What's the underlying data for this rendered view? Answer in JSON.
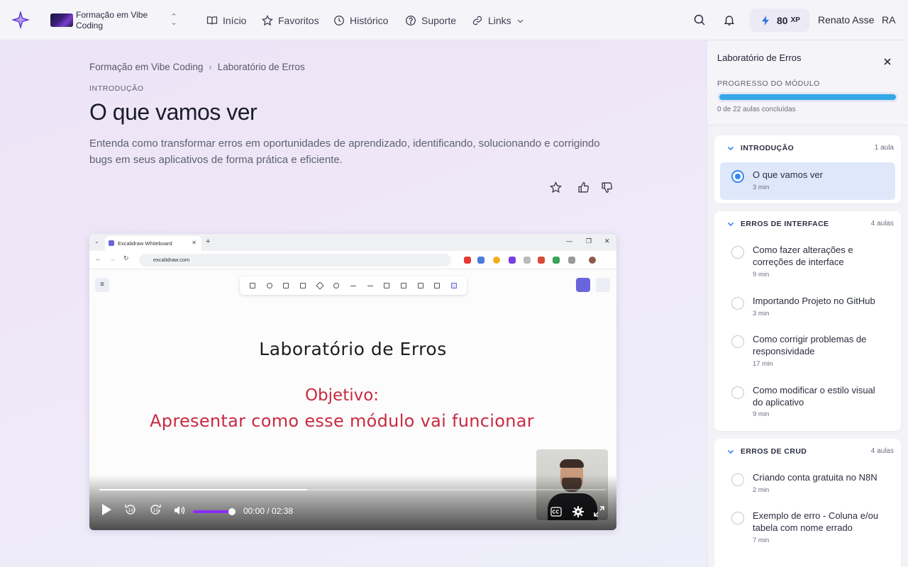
{
  "topbar": {
    "course_name": "Formação em Vibe Coding",
    "nav": [
      {
        "label": "Início",
        "icon": "book-icon"
      },
      {
        "label": "Favoritos",
        "icon": "star-icon"
      },
      {
        "label": "Histórico",
        "icon": "clock-icon"
      },
      {
        "label": "Suporte",
        "icon": "help-circle-icon"
      },
      {
        "label": "Links",
        "icon": "link-icon"
      }
    ],
    "xp_value": "80",
    "xp_unit": "XP",
    "username": "Renato Asse",
    "initials": "RA",
    "accent": "#8b2cf5"
  },
  "main": {
    "breadcrumb": [
      "Formação em Vibe Coding",
      "Laboratório de Erros"
    ],
    "section_label": "INTRODUÇÃO",
    "title": "O que vamos ver",
    "description": "Entenda como transformar erros em oportunidades de aprendizado, identificando, solucionando e corrigindo bugs em seus aplicativos de forma prática e eficiente."
  },
  "video": {
    "browser_tab": "Excalidraw Whiteboard",
    "url": "excalidraw.com",
    "whiteboard_title": "Laboratório de Erros",
    "whiteboard_objective": "Objetivo:",
    "whiteboard_subtitle": "Apresentar como esse módulo vai funcionar",
    "time": "00:00 / 02:38",
    "played_fraction": 0.41,
    "volume_fraction": 1.0
  },
  "sidebar": {
    "title": "Laboratório de Erros",
    "progress_label": "PROGRESSO DO MÓDULO",
    "progress_text": "0 de 22 aulas concluídas",
    "progress_fraction": 1.0,
    "groups": [
      {
        "title": "INTRODUÇÃO",
        "count": "1 aula",
        "lessons": [
          {
            "title": "O que vamos ver",
            "duration": "3 min",
            "active": true
          }
        ]
      },
      {
        "title": "ERROS DE INTERFACE",
        "count": "4 aulas",
        "lessons": [
          {
            "title": "Como fazer alterações e correções de interface",
            "duration": "9 min"
          },
          {
            "title": "Importando Projeto no GitHub",
            "duration": "3 min"
          },
          {
            "title": "Como corrigir problemas de responsividade",
            "duration": "17 min"
          },
          {
            "title": "Como modificar o estilo visual do aplicativo",
            "duration": "9 min"
          }
        ]
      },
      {
        "title": "ERROS DE CRUD",
        "count": "4 aulas",
        "lessons": [
          {
            "title": "Criando conta gratuita no N8N",
            "duration": "2 min"
          },
          {
            "title": "Exemplo de erro - Coluna e/ou tabela com nome errado",
            "duration": "7 min"
          }
        ]
      }
    ]
  }
}
